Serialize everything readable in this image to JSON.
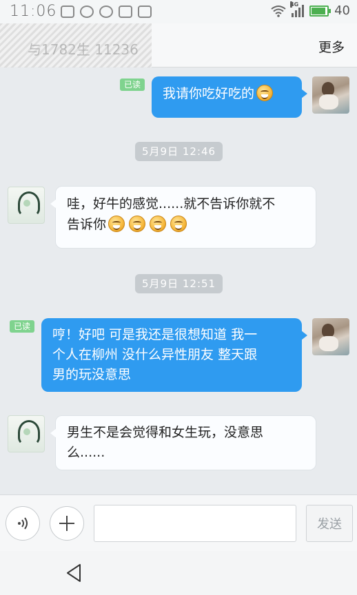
{
  "status_bar": {
    "time": "11:06",
    "network": "4G",
    "battery": "40"
  },
  "header": {
    "title": "与1782生 11236",
    "more_label": "更多"
  },
  "messages": [
    {
      "side": "me",
      "text": "我请你吃好吃的",
      "emoji_count": 1,
      "read_label": "已读"
    },
    {
      "timestamp": "5月9日 12:46"
    },
    {
      "side": "other",
      "text": "哇，好牛的感觉......就不告诉你就不告诉你",
      "emoji_count": 4
    },
    {
      "timestamp": "5月9日 12:51"
    },
    {
      "side": "me",
      "text": "哼！好吧 可是我还是很想知道 我一个人在柳州 没什么异性朋友 整天跟男的玩没意思",
      "read_label": "已读"
    },
    {
      "side": "other",
      "text": "男生不是会觉得和女生玩，没意思么......"
    }
  ],
  "chat": {
    "msg1_read": "已读",
    "msg1_text": "我请你吃好吃的",
    "time1": "5月9日 12:46",
    "msg2_line1": "哇，好牛的感觉......就不告诉你就不",
    "msg2_line2": "告诉你",
    "time2": "5月9日 12:51",
    "msg3_read": "已读",
    "msg3_line1": "哼！好吧 可是我还是很想知道 我一",
    "msg3_line2": "个人在柳州 没什么异性朋友 整天跟",
    "msg3_line3": "男的玩没意思",
    "msg4_line1": "男生不是会觉得和女生玩，没意思",
    "msg4_line2": "么......"
  },
  "input_bar": {
    "placeholder": "",
    "send_label": "发送"
  },
  "icons": {
    "voice": "voice-icon",
    "add": "plus-icon",
    "back": "back-triangle-icon"
  },
  "colors": {
    "my_bubble": "#2f9bf0",
    "read_badge": "#7fd38e",
    "battery": "#4caf50"
  }
}
